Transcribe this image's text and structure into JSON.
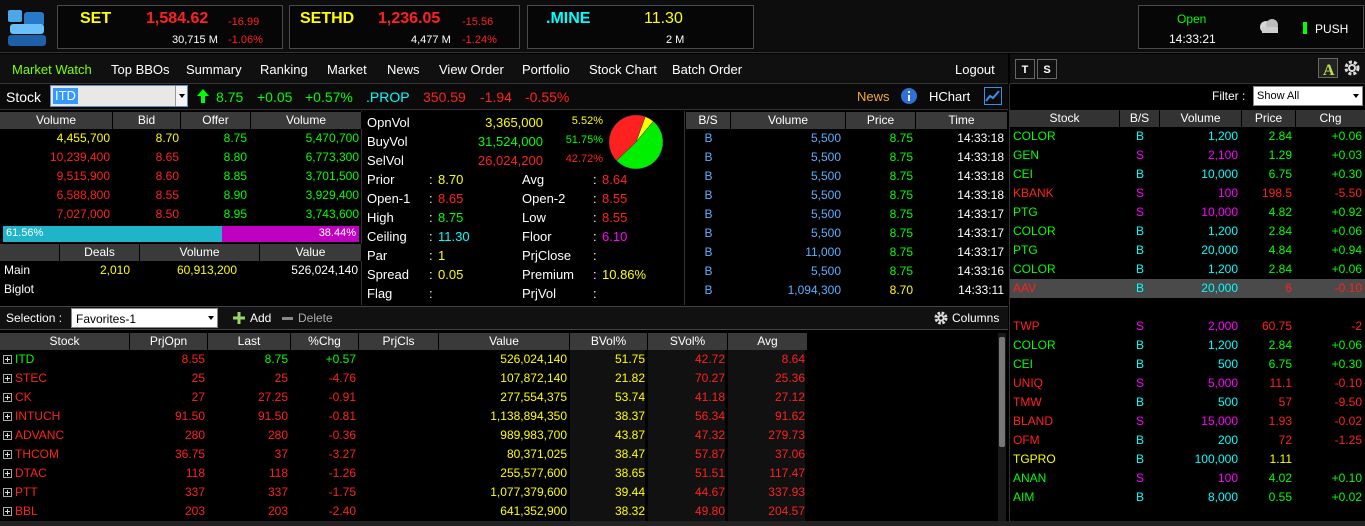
{
  "indices": [
    {
      "name": "SET",
      "value": "1,584.62",
      "change": "-16.99",
      "volume": "30,715 M",
      "pct": "-1.06%"
    },
    {
      "name": "SETHD",
      "value": "1,236.05",
      "change": "-15.56",
      "volume": "4,477 M",
      "pct": "-1.24%"
    },
    {
      "name": ".MINE",
      "value": "11.30",
      "volume": "2 M"
    }
  ],
  "market": {
    "status": "Open",
    "time": "14:33:21",
    "push_label": "PUSH"
  },
  "menu": [
    "Market Watch",
    "Top BBOs",
    "Summary",
    "Ranking",
    "Market",
    "News",
    "View Order",
    "Portfolio",
    "Stock Chart",
    "Batch Order"
  ],
  "logout": "Logout",
  "right_tabs": [
    "T",
    "S"
  ],
  "stock_bar": {
    "label": "Stock",
    "symbol": "ITD",
    "last": "8.75",
    "change": "+0.05",
    "pct": "+0.57%",
    "sector": ".PROP",
    "sector_value": "350.59",
    "sector_change": "-1.94",
    "sector_pct": "-0.55%",
    "news": "News",
    "hchart": "HChart"
  },
  "bbo": {
    "headers": [
      "Volume",
      "Bid",
      "Offer",
      "Volume"
    ],
    "rows": [
      [
        "4,455,700",
        "8.70",
        "8.75",
        "5,470,700"
      ],
      [
        "10,239,400",
        "8.65",
        "8.80",
        "6,773,300"
      ],
      [
        "9,515,900",
        "8.60",
        "8.85",
        "3,701,500"
      ],
      [
        "6,588,800",
        "8.55",
        "8.90",
        "3,929,400"
      ],
      [
        "7,027,000",
        "8.50",
        "8.95",
        "3,743,600"
      ]
    ],
    "bid_pct_label": "61.56%",
    "offer_pct_label": "38.44%",
    "bid_fraction": 0.6156
  },
  "deals": {
    "headers": [
      "Deals",
      "Volume",
      "Value"
    ],
    "rows": [
      {
        "label": "Main",
        "deals": "2,010",
        "volume": "60,913,200",
        "value": "526,024,140"
      },
      {
        "label": "Biglot",
        "deals": "",
        "volume": "",
        "value": ""
      }
    ]
  },
  "quote": {
    "opnvol_label": "OpnVol",
    "opnvol": "3,365,000",
    "opnvol_pct": "5.52%",
    "buyvol_label": "BuyVol",
    "buyvol": "31,524,000",
    "buyvol_pct": "51.75%",
    "selvol_label": "SelVol",
    "selvol": "26,024,200",
    "selvol_pct": "42.72%",
    "fields_left": [
      {
        "label": "Prior",
        "value": "8.70"
      },
      {
        "label": "Open-1",
        "value": "8.65"
      },
      {
        "label": "High",
        "value": "8.75"
      },
      {
        "label": "Ceiling",
        "value": "11.30"
      },
      {
        "label": "Par",
        "value": "1"
      },
      {
        "label": "Spread",
        "value": "0.05"
      },
      {
        "label": "Flag",
        "value": ""
      }
    ],
    "fields_right": [
      {
        "label": "Avg",
        "value": "8.64"
      },
      {
        "label": "Open-2",
        "value": "8.55"
      },
      {
        "label": "Low",
        "value": "8.55"
      },
      {
        "label": "Floor",
        "value": "6.10"
      },
      {
        "label": "PrjClose",
        "value": ""
      },
      {
        "label": "Premium",
        "value": "10.86%"
      },
      {
        "label": "PrjVol",
        "value": ""
      }
    ]
  },
  "pie": {
    "open": 0.0552,
    "buy": 0.5175,
    "sell": 0.4272,
    "colors": {
      "open": "#ffff00",
      "buy": "#00ee00",
      "sell": "#ff2020"
    }
  },
  "ticker": {
    "headers": [
      "B/S",
      "Volume",
      "Price",
      "Time"
    ],
    "rows": [
      [
        "B",
        "5,500",
        "8.75",
        "14:33:18"
      ],
      [
        "B",
        "5,500",
        "8.75",
        "14:33:18"
      ],
      [
        "B",
        "5,500",
        "8.75",
        "14:33:18"
      ],
      [
        "B",
        "5,500",
        "8.75",
        "14:33:18"
      ],
      [
        "B",
        "5,500",
        "8.75",
        "14:33:17"
      ],
      [
        "B",
        "5,500",
        "8.75",
        "14:33:17"
      ],
      [
        "B",
        "11,000",
        "8.75",
        "14:33:17"
      ],
      [
        "B",
        "5,500",
        "8.75",
        "14:33:16"
      ],
      [
        "B",
        "1,094,300",
        "8.70",
        "14:33:11"
      ]
    ]
  },
  "selection": {
    "label": "Selection :",
    "value": "Favorites-1",
    "add": "Add",
    "delete": "Delete",
    "columns": "Columns"
  },
  "watch": {
    "headers": [
      "Stock",
      "PrjOpn",
      "Last",
      "%Chg",
      "PrjCls",
      "Value",
      "BVol%",
      "SVol%",
      "Avg"
    ],
    "rows": [
      {
        "stock": "ITD",
        "prjopn": "8.55",
        "last": "8.75",
        "chg": "+0.57",
        "prjcls": "",
        "value": "526,024,140",
        "bvol": "51.75",
        "svol": "42.72",
        "avg": "8.64",
        "color": "g"
      },
      {
        "stock": "STEC",
        "prjopn": "25",
        "last": "25",
        "chg": "-4.76",
        "prjcls": "",
        "value": "107,872,140",
        "bvol": "21.82",
        "svol": "70.27",
        "avg": "25.36",
        "color": "rd"
      },
      {
        "stock": "CK",
        "prjopn": "27",
        "last": "27.25",
        "chg": "-0.91",
        "prjcls": "",
        "value": "277,554,375",
        "bvol": "53.74",
        "svol": "41.18",
        "avg": "27.12",
        "color": "rd"
      },
      {
        "stock": "INTUCH",
        "prjopn": "91.50",
        "last": "91.50",
        "chg": "-0.81",
        "prjcls": "",
        "value": "1,138,894,350",
        "bvol": "38.37",
        "svol": "56.34",
        "avg": "91.62",
        "color": "rd"
      },
      {
        "stock": "ADVANC",
        "prjopn": "280",
        "last": "280",
        "chg": "-0.36",
        "prjcls": "",
        "value": "989,983,700",
        "bvol": "43.87",
        "svol": "47.32",
        "avg": "279.73",
        "color": "rd"
      },
      {
        "stock": "THCOM",
        "prjopn": "36.75",
        "last": "37",
        "chg": "-3.27",
        "prjcls": "",
        "value": "80,371,025",
        "bvol": "38.47",
        "svol": "57.87",
        "avg": "37.06",
        "color": "rd"
      },
      {
        "stock": "DTAC",
        "prjopn": "118",
        "last": "118",
        "chg": "-1.26",
        "prjcls": "",
        "value": "255,577,600",
        "bvol": "38.65",
        "svol": "51.51",
        "avg": "117.47",
        "color": "rd"
      },
      {
        "stock": "PTT",
        "prjopn": "337",
        "last": "337",
        "chg": "-1.75",
        "prjcls": "",
        "value": "1,077,379,600",
        "bvol": "39.44",
        "svol": "44.67",
        "avg": "337.93",
        "color": "rd"
      },
      {
        "stock": "BBL",
        "prjopn": "203",
        "last": "203",
        "chg": "-2.40",
        "prjcls": "",
        "value": "641,352,900",
        "bvol": "38.32",
        "svol": "49.80",
        "avg": "204.57",
        "color": "rd"
      }
    ]
  },
  "filter": {
    "label": "Filter :",
    "value": "Show All"
  },
  "ticker2": {
    "headers": [
      "Stock",
      "B/S",
      "Volume",
      "Price",
      "Chg"
    ],
    "rows": [
      {
        "stock": "COLOR",
        "bs": "B",
        "volume": "1,200",
        "price": "2.84",
        "chg": "+0.06",
        "color": "g"
      },
      {
        "stock": "GEN",
        "bs": "S",
        "volume": "2,100",
        "price": "1.29",
        "chg": "+0.03",
        "color": "g"
      },
      {
        "stock": "CEI",
        "bs": "B",
        "volume": "10,000",
        "price": "6.75",
        "chg": "+0.30",
        "color": "g"
      },
      {
        "stock": "KBANK",
        "bs": "S",
        "volume": "100",
        "price": "198.5",
        "chg": "-5.50",
        "color": "rd"
      },
      {
        "stock": "PTG",
        "bs": "S",
        "volume": "10,000",
        "price": "4.82",
        "chg": "+0.92",
        "color": "g"
      },
      {
        "stock": "COLOR",
        "bs": "B",
        "volume": "1,200",
        "price": "2.84",
        "chg": "+0.06",
        "color": "g"
      },
      {
        "stock": "PTG",
        "bs": "B",
        "volume": "20,000",
        "price": "4.84",
        "chg": "+0.94",
        "color": "g"
      },
      {
        "stock": "COLOR",
        "bs": "B",
        "volume": "1,200",
        "price": "2.84",
        "chg": "+0.06",
        "color": "g"
      },
      {
        "stock": "AAV",
        "bs": "B",
        "volume": "20,000",
        "price": "6",
        "chg": "-0.10",
        "color": "rd",
        "selected": true
      },
      {
        "stock": "",
        "bs": "",
        "volume": "",
        "price": "",
        "chg": "",
        "color": "w"
      },
      {
        "stock": "TWP",
        "bs": "S",
        "volume": "2,000",
        "price": "60.75",
        "chg": "-2",
        "color": "rd"
      },
      {
        "stock": "COLOR",
        "bs": "B",
        "volume": "1,200",
        "price": "2.84",
        "chg": "+0.06",
        "color": "g"
      },
      {
        "stock": "CEI",
        "bs": "B",
        "volume": "500",
        "price": "6.75",
        "chg": "+0.30",
        "color": "g"
      },
      {
        "stock": "UNIQ",
        "bs": "S",
        "volume": "5,000",
        "price": "11.1",
        "chg": "-0.10",
        "color": "rd"
      },
      {
        "stock": "TMW",
        "bs": "B",
        "volume": "500",
        "price": "57",
        "chg": "-9.50",
        "color": "rd"
      },
      {
        "stock": "BLAND",
        "bs": "S",
        "volume": "15,000",
        "price": "1.93",
        "chg": "-0.02",
        "color": "rd"
      },
      {
        "stock": "OFM",
        "bs": "B",
        "volume": "200",
        "price": "72",
        "chg": "-1.25",
        "color": "rd"
      },
      {
        "stock": "TGPRO",
        "bs": "B",
        "volume": "100,000",
        "price": "1.11",
        "chg": "",
        "color": "y"
      },
      {
        "stock": "ANAN",
        "bs": "S",
        "volume": "100",
        "price": "4.02",
        "chg": "+0.10",
        "color": "g"
      },
      {
        "stock": "AIM",
        "bs": "B",
        "volume": "8,000",
        "price": "0.55",
        "chg": "+0.02",
        "color": "g"
      }
    ]
  }
}
